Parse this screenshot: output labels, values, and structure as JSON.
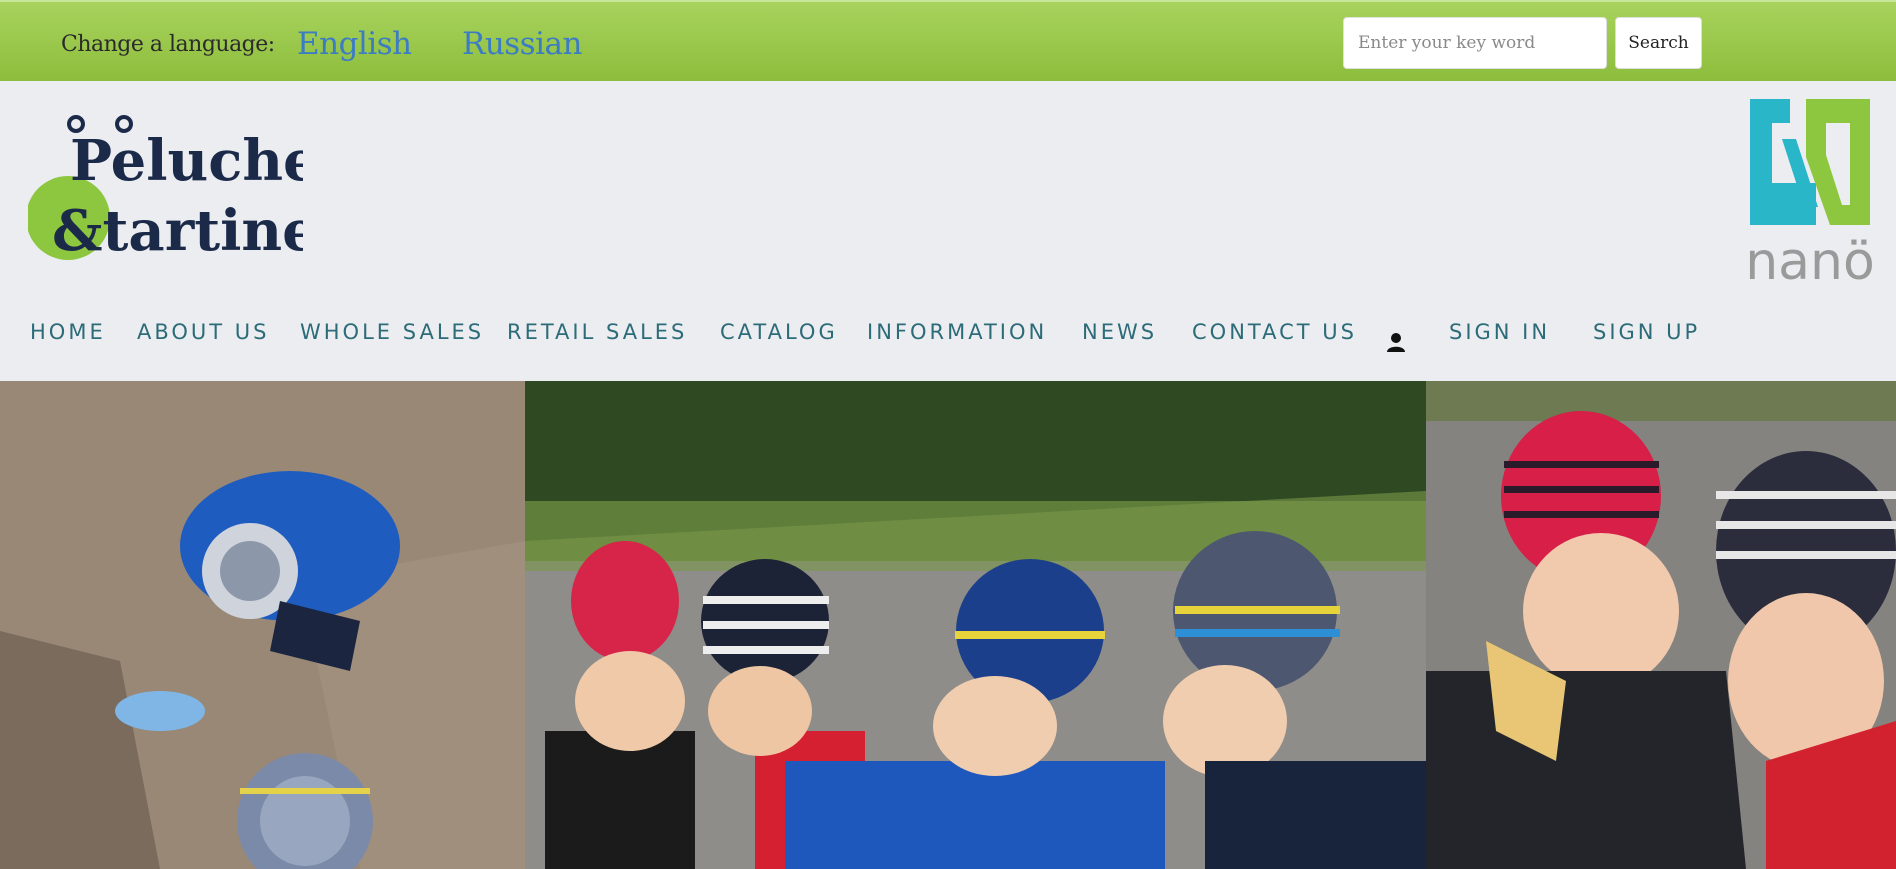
{
  "topbar": {
    "lang_label": "Change a language:",
    "lang_english": "English",
    "lang_russian": "Russian",
    "search_placeholder": "Enter your key word",
    "search_button": "Search"
  },
  "brand": {
    "logo_line1": "Peluche",
    "logo_line2": "&tartine",
    "partner_logo_text": "nanö",
    "colors": {
      "green": "#8dc63f",
      "navy": "#1c2a4a",
      "teal": "#29b6c8",
      "gray": "#9a9a9a"
    }
  },
  "nav": {
    "items": [
      "HOME",
      "ABOUT US",
      "WHOLE SALES",
      "RETAIL SALES",
      "CATALOG",
      "INFORMATION",
      "NEWS",
      "CONTACT US"
    ],
    "user_icon": "user-icon",
    "sign_in": "SIGN IN",
    "sign_up": "SIGN UP"
  },
  "colors": {
    "topbar_green": "#9ccb4e",
    "nav_text": "#2c6b78",
    "link_blue": "#3b7cc4",
    "page_bg": "#ecedf1"
  }
}
